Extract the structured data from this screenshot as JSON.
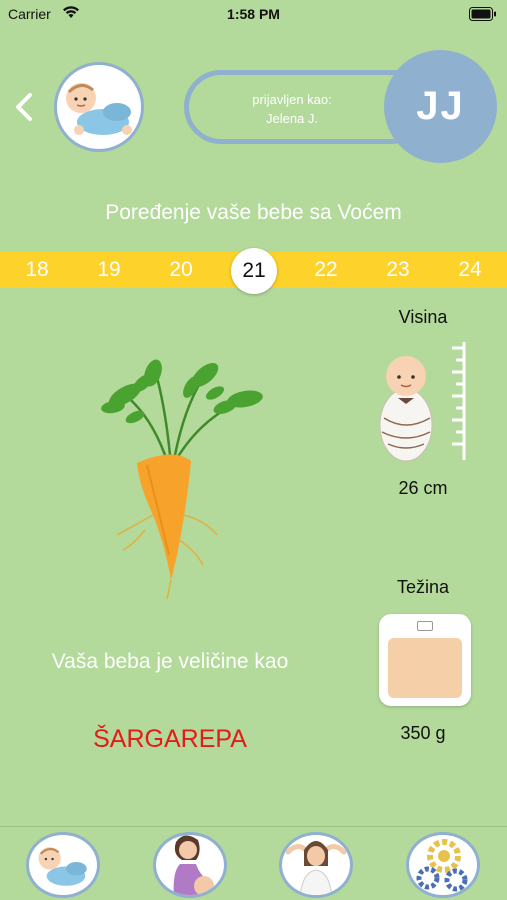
{
  "status_bar": {
    "carrier": "Carrier",
    "time": "1:58 PM"
  },
  "header": {
    "logged_in_label": "prijavljen kao:",
    "user_name": "Jelena J.",
    "initials": "JJ"
  },
  "title": "Poređenje vaše bebe sa Voćem",
  "weeks": [
    "18",
    "19",
    "20",
    "21",
    "22",
    "23",
    "24"
  ],
  "selected_week": "21",
  "size_text": "Vaša beba je veličine kao",
  "fruit_name": "ŠARGAREPA",
  "height": {
    "label": "Visina",
    "value": "26 cm"
  },
  "weight": {
    "label": "Težina",
    "value": "350 g"
  },
  "tabs": [
    "baby-tab",
    "pregnancy-tab",
    "mother-tab",
    "settings-tab"
  ],
  "colors": {
    "background": "#b3d99b",
    "accent_blue": "#8fb1cf",
    "week_bar": "#fdd22b",
    "fruit_name": "#e41b17"
  }
}
